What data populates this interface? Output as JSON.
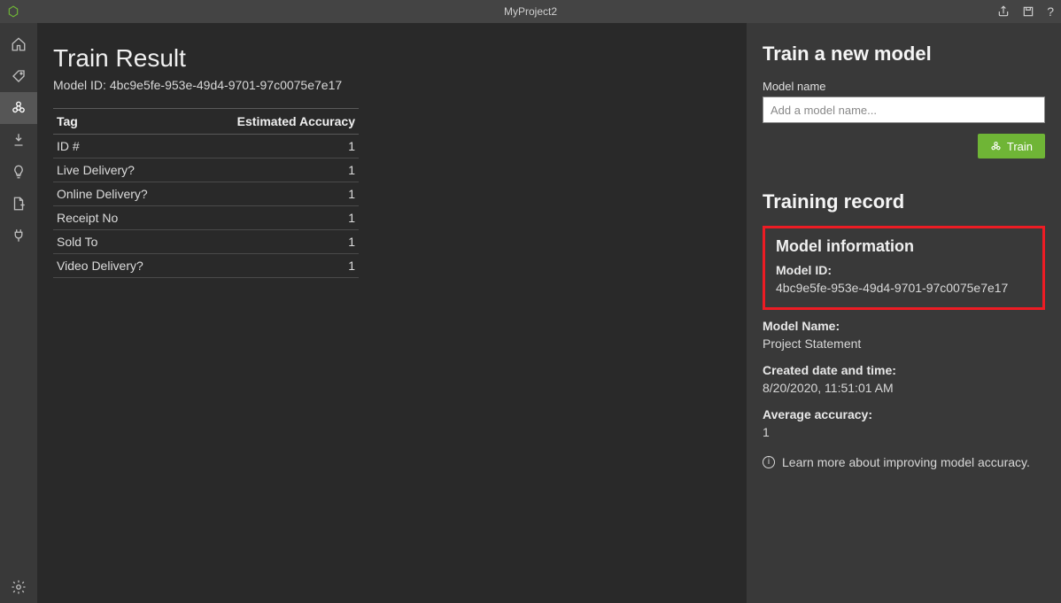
{
  "titlebar": {
    "title": "MyProject2"
  },
  "sidebar": {
    "items": [
      {
        "name": "home-icon"
      },
      {
        "name": "tag-icon"
      },
      {
        "name": "model-icon"
      },
      {
        "name": "compose-icon"
      },
      {
        "name": "lightbulb-icon"
      },
      {
        "name": "new-file-icon"
      },
      {
        "name": "plug-icon"
      }
    ]
  },
  "main": {
    "heading": "Train Result",
    "model_id_prefix": "Model ID: ",
    "model_id": "4bc9e5fe-953e-49d4-9701-97c0075e7e17",
    "columns": {
      "tag": "Tag",
      "accuracy": "Estimated Accuracy"
    },
    "rows": [
      {
        "tag": "ID #",
        "accuracy": "1"
      },
      {
        "tag": "Live Delivery?",
        "accuracy": "1"
      },
      {
        "tag": "Online Delivery?",
        "accuracy": "1"
      },
      {
        "tag": "Receipt No",
        "accuracy": "1"
      },
      {
        "tag": "Sold To",
        "accuracy": "1"
      },
      {
        "tag": "Video Delivery?",
        "accuracy": "1"
      }
    ]
  },
  "right": {
    "train_new_heading": "Train a new model",
    "model_name_label": "Model name",
    "model_name_placeholder": "Add a model name...",
    "train_button": "Train",
    "training_record_heading": "Training record",
    "model_info_heading": "Model information",
    "model_id_label": "Model ID:",
    "model_id_value": "4bc9e5fe-953e-49d4-9701-97c0075e7e17",
    "model_name_info_label": "Model Name:",
    "model_name_info_value": "Project Statement",
    "created_label": "Created date and time:",
    "created_value": "8/20/2020, 11:51:01 AM",
    "avg_acc_label": "Average accuracy:",
    "avg_acc_value": "1",
    "learn_more": "Learn more about improving model accuracy."
  }
}
